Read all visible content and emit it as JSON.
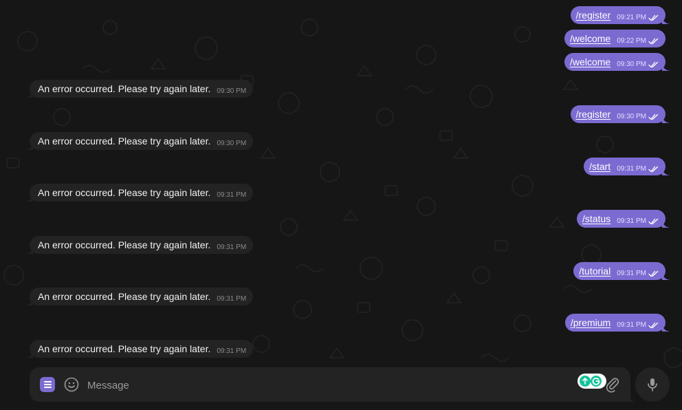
{
  "messages": [
    {
      "id": "m1",
      "side": "out",
      "text": "/register",
      "time": "09:21 PM"
    },
    {
      "id": "m2",
      "side": "out",
      "text": "/welcome",
      "time": "09:22 PM"
    },
    {
      "id": "m3",
      "side": "out",
      "text": "/welcome",
      "time": "09:30 PM"
    },
    {
      "id": "m4",
      "side": "in",
      "text": "An error occurred. Please try again later.",
      "time": "09:30 PM"
    },
    {
      "id": "m5",
      "side": "out",
      "text": "/register",
      "time": "09:30 PM"
    },
    {
      "id": "m6",
      "side": "in",
      "text": "An error occurred. Please try again later.",
      "time": "09:30 PM"
    },
    {
      "id": "m7",
      "side": "out",
      "text": "/start",
      "time": "09:31 PM"
    },
    {
      "id": "m8",
      "side": "in",
      "text": "An error occurred. Please try again later.",
      "time": "09:31 PM"
    },
    {
      "id": "m9",
      "side": "out",
      "text": "/status",
      "time": "09:31 PM"
    },
    {
      "id": "m10",
      "side": "in",
      "text": "An error occurred. Please try again later.",
      "time": "09:31 PM"
    },
    {
      "id": "m11",
      "side": "out",
      "text": "/tutorial",
      "time": "09:31 PM"
    },
    {
      "id": "m12",
      "side": "in",
      "text": "An error occurred. Please try again later.",
      "time": "09:31 PM"
    },
    {
      "id": "m13",
      "side": "out",
      "text": "/premium",
      "time": "09:31 PM"
    },
    {
      "id": "m14",
      "side": "in",
      "text": "An error occurred. Please try again later.",
      "time": "09:31 PM"
    }
  ],
  "composer": {
    "placeholder": "Message",
    "icons": {
      "menu": "bot-menu-icon",
      "emoji": "smiley-icon",
      "extension": "grammarly-extension-icon",
      "attach": "paperclip-icon",
      "mic": "microphone-icon"
    }
  },
  "colors": {
    "background": "#161616",
    "outgoing_bubble": "#7b6bd1",
    "incoming_bubble": "#232323",
    "composer": "#232323"
  }
}
